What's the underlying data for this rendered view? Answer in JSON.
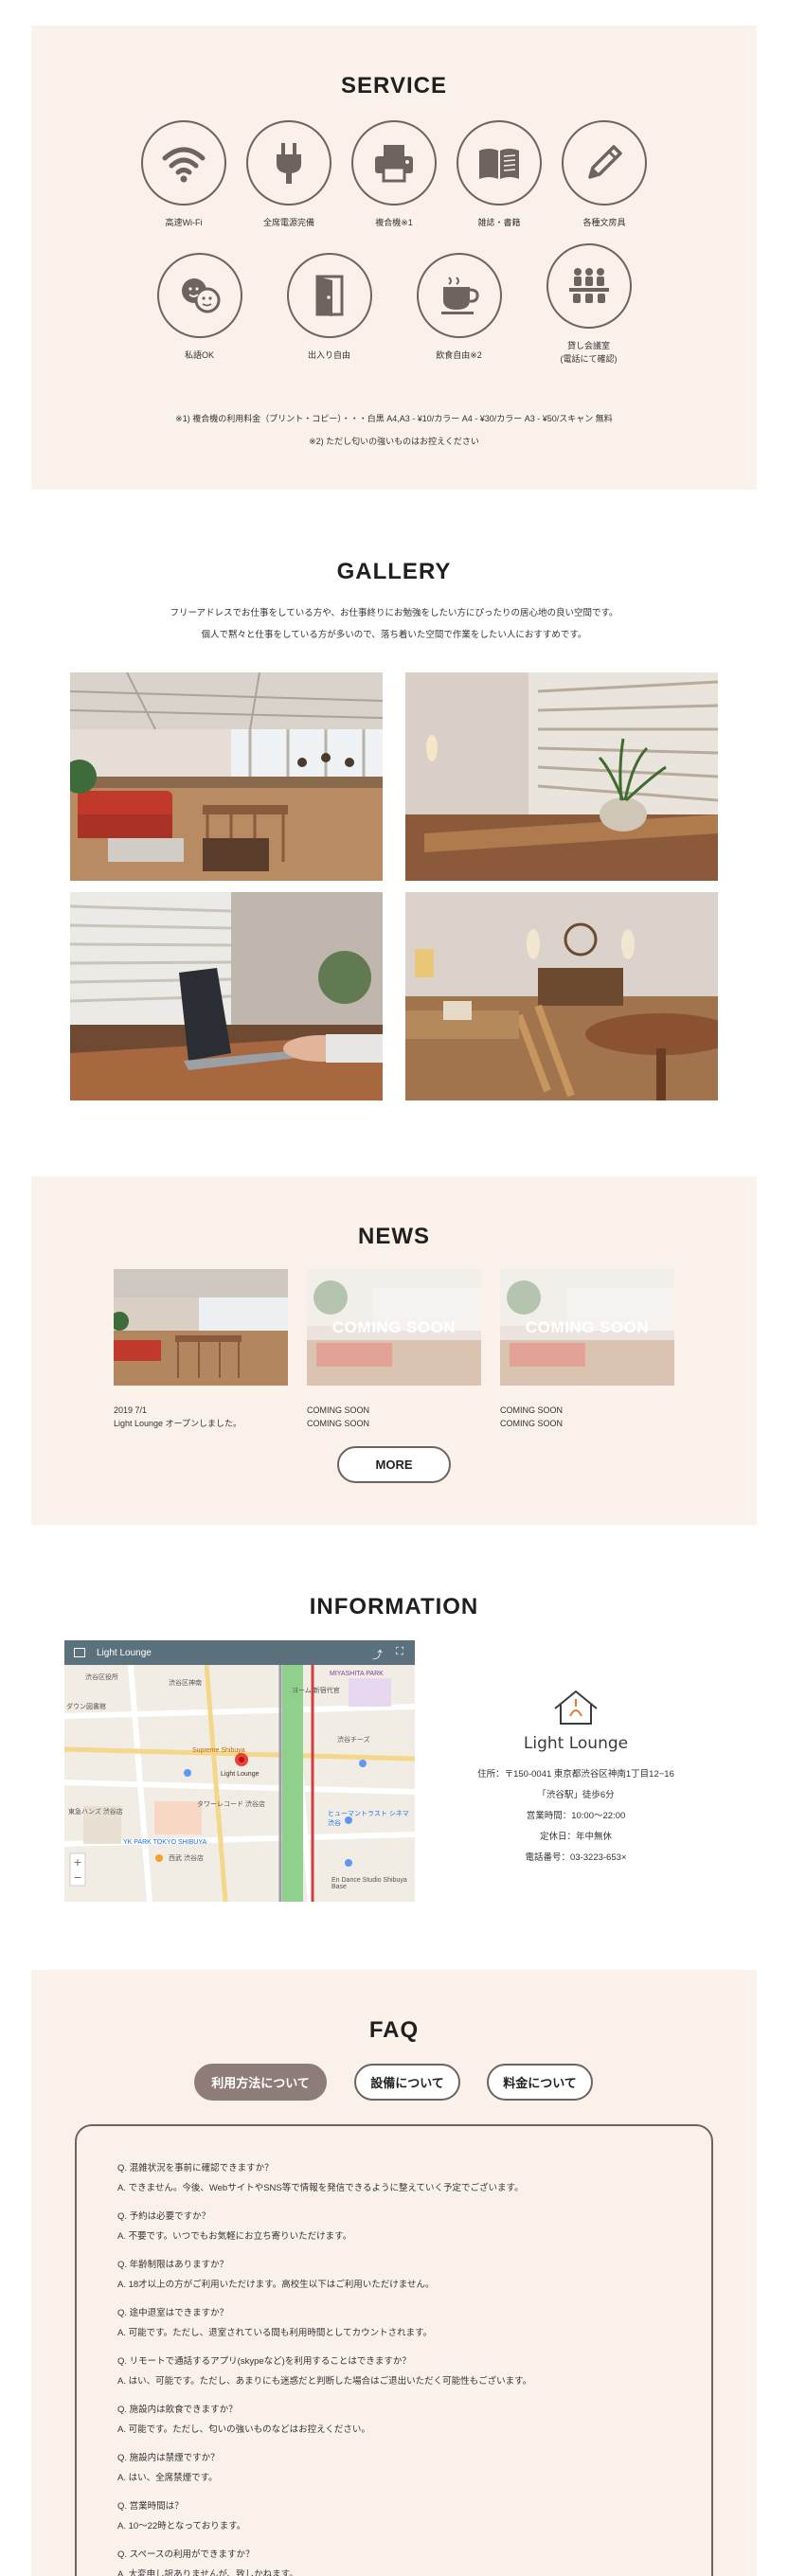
{
  "service": {
    "title": "SERVICE",
    "items": [
      {
        "label": "高速Wi-Fi",
        "icon": "wifi-icon"
      },
      {
        "label": "全席電源完備",
        "icon": "power-plug-icon"
      },
      {
        "label": "複合機※1",
        "icon": "printer-icon"
      },
      {
        "label": "雑誌・書籍",
        "icon": "book-icon"
      },
      {
        "label": "各種文房具",
        "icon": "pencil-icon"
      },
      {
        "label": "私語OK",
        "icon": "chat-faces-icon"
      },
      {
        "label": "出入り自由",
        "icon": "door-icon"
      },
      {
        "label": "飲食自由※2",
        "icon": "coffee-cup-icon"
      },
      {
        "label1": "貸し会議室",
        "label2": "(電話にて確認)",
        "icon": "meeting-room-icon"
      }
    ],
    "note1": "※1) 複合機の利用料金（プリント・コピー）・・・白黒 A4,A3 - ¥10/カラー A4 - ¥30/カラー A3 - ¥50/スキャン 無料",
    "note2": "※2) ただし匂いの強いものはお控えください"
  },
  "gallery": {
    "title": "GALLERY",
    "desc1": "フリーアドレスでお仕事をしている方や、お仕事終りにお勉強をしたい方にぴったりの居心地の良い空間です。",
    "desc2": "個人で黙々と仕事をしている方が多いので、落ち着いた空間で作業をしたい人におすすめです。"
  },
  "news": {
    "title": "NEWS",
    "items": [
      {
        "date": "2019 7/1",
        "text": "Light Lounge オープンしました。",
        "overlay": ""
      },
      {
        "date": "COMING SOON",
        "text": "COMING SOON",
        "overlay": "COMING SOON"
      },
      {
        "date": "COMING SOON",
        "text": "COMING SOON",
        "overlay": "COMING SOON"
      }
    ],
    "more_label": "MORE"
  },
  "information": {
    "title": "INFORMATION",
    "map_title": "Light Lounge",
    "map_pin_label": "Light Lounge",
    "map_labels": [
      "渋谷区役所",
      "ダウン図書館",
      "渋谷区神南",
      "Supreme Shibuya",
      "タワーレコード 渋谷店",
      "MIYASHITA PARK",
      "YK PARK TOKYO SHIBUYA",
      "ヨーム 新宿代官",
      "渋谷チーズ",
      "ヒューマントラスト シネマ渋谷",
      "En Dance Studio Shibuya Base",
      "東急ハンズ 渋谷店",
      "西武 渋谷店"
    ],
    "brand": "Light Lounge",
    "address": "住所：〒150-0041 東京都渋谷区神南1丁目12−16",
    "station": "「渋谷駅」徒歩6分",
    "hours": "営業時間：10:00～22:00",
    "holiday": "定休日：年中無休",
    "phone": "電話番号：03-3223-653×"
  },
  "faq": {
    "title": "FAQ",
    "tabs": [
      "利用方法について",
      "設備について",
      "料金について"
    ],
    "items": [
      {
        "q": "Q. 混雑状況を事前に確認できますか？",
        "a": "A. できません。今後、WebサイトやSNS等で情報を発信できるように整えていく予定でございます。"
      },
      {
        "q": "Q. 予約は必要ですか？",
        "a": "A. 不要です。いつでもお気軽にお立ち寄りいただけます。"
      },
      {
        "q": "Q. 年齢制限はありますか？",
        "a": "A. 18才以上の方がご利用いただけます。高校生以下はご利用いただけません。"
      },
      {
        "q": "Q. 途中退室はできますか？",
        "a": "A. 可能です。ただし、退室されている間も利用時間としてカウントされます。"
      },
      {
        "q": "Q. リモートで通話するアプリ(skypeなど)を利用することはできますか？",
        "a": "A. はい、可能です。ただし、あまりにも迷惑だと判断した場合はご退出いただく可能性もございます。"
      },
      {
        "q": "Q. 施設内は飲食できますか？",
        "a": "A. 可能です。ただし、匂いの強いものなどはお控えください。"
      },
      {
        "q": "Q. 施設内は禁煙ですか？",
        "a": "A. はい、全席禁煙です。"
      },
      {
        "q": "Q. 営業時間は？",
        "a": "A. 10～22時となっております。"
      },
      {
        "q": "Q. スペースの利用ができますか？",
        "a": "A. 大変申し訳ありませんが、致しかねます。"
      }
    ]
  }
}
